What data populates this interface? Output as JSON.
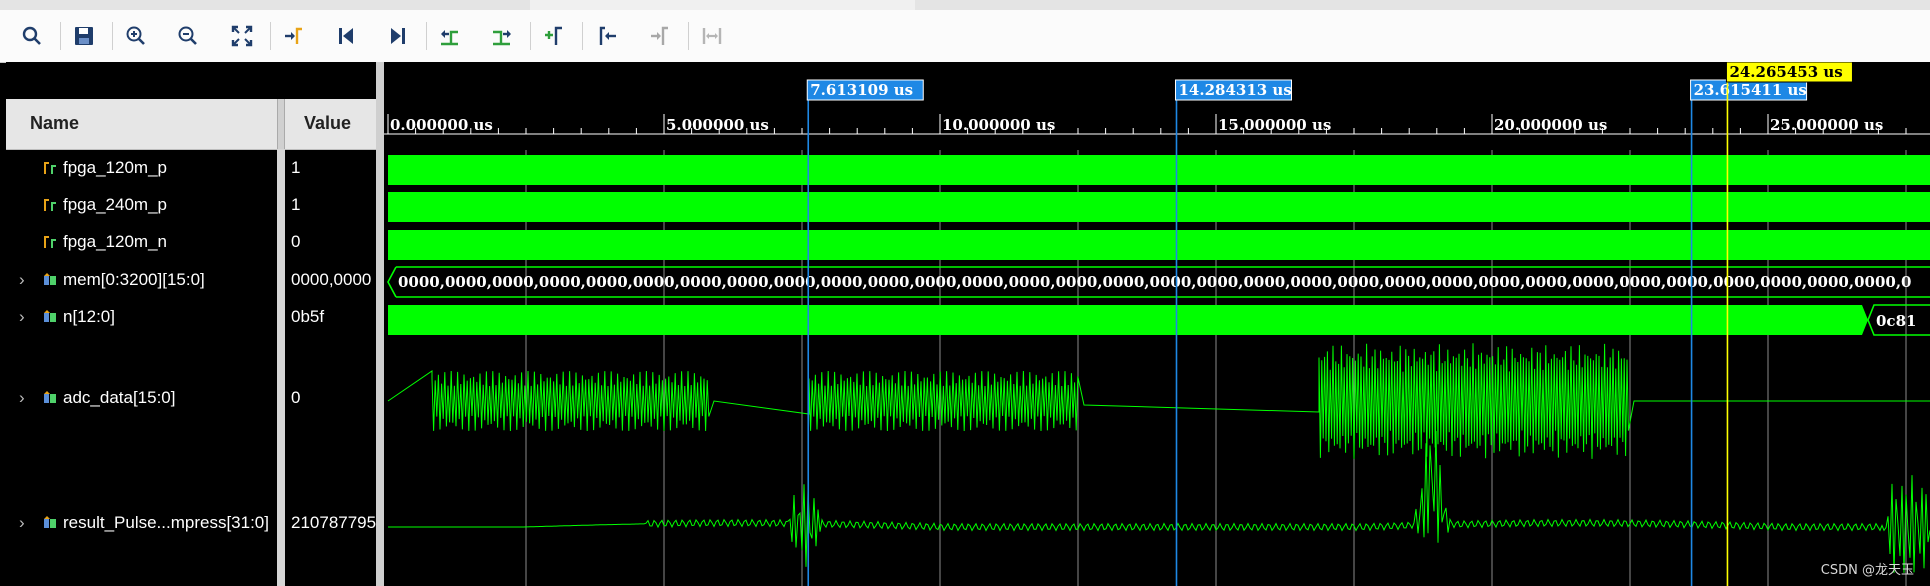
{
  "toolbar": {
    "buttons": [
      {
        "name": "search-button",
        "icon": "search-icon"
      },
      {
        "name": "save-button",
        "icon": "save-icon"
      },
      {
        "name": "zoom-in-button",
        "icon": "zoom-in-icon"
      },
      {
        "name": "zoom-out-button",
        "icon": "zoom-out-icon"
      },
      {
        "name": "zoom-fit-button",
        "icon": "zoom-fit-icon"
      },
      {
        "name": "goto-cursor-button",
        "icon": "goto-cursor-icon"
      },
      {
        "name": "goto-start-button",
        "icon": "goto-start-icon"
      },
      {
        "name": "goto-end-button",
        "icon": "goto-end-icon"
      },
      {
        "name": "previous-transition-button",
        "icon": "prev-transition-icon"
      },
      {
        "name": "next-transition-button",
        "icon": "next-transition-icon"
      },
      {
        "name": "add-marker-button",
        "icon": "add-marker-icon"
      },
      {
        "name": "previous-marker-button",
        "icon": "prev-marker-icon"
      },
      {
        "name": "next-marker-button",
        "icon": "next-marker-icon"
      },
      {
        "name": "swap-cursors-button",
        "icon": "swap-cursors-icon"
      }
    ]
  },
  "header": {
    "name_col": "Name",
    "value_col": "Value"
  },
  "signals": [
    {
      "name": "fpga_120m_p",
      "value": "1",
      "expandable": false,
      "icon": "bit-signal-icon"
    },
    {
      "name": "fpga_240m_p",
      "value": "1",
      "expandable": false,
      "icon": "bit-signal-icon"
    },
    {
      "name": "fpga_120m_n",
      "value": "0",
      "expandable": false,
      "icon": "bit-signal-icon"
    },
    {
      "name": "mem[0:3200][15:0]",
      "value": "0000,0000",
      "expandable": true,
      "icon": "bus-signal-icon"
    },
    {
      "name": "n[12:0]",
      "value": "0b5f",
      "expandable": true,
      "icon": "bus-signal-icon"
    },
    {
      "name": "adc_data[15:0]",
      "value": "0",
      "expandable": true,
      "icon": "bus-signal-icon"
    },
    {
      "name": "result_Pulse...mpress[31:0]",
      "value": "210787795",
      "expandable": true,
      "icon": "bus-signal-icon"
    }
  ],
  "timeline": {
    "ticks": [
      "0.000000 us",
      "5.000000 us",
      "10.000000 us",
      "15.000000 us",
      "20.000000 us",
      "25.000000 us"
    ],
    "tick_values_us": [
      0,
      5,
      10,
      15,
      20,
      25
    ],
    "us_per_major": 5
  },
  "markers": [
    {
      "label": "7.613109 us",
      "time_us": 7.613109,
      "kind": "marker",
      "color": "#1e88e5"
    },
    {
      "label": "14.284313 us",
      "time_us": 14.284313,
      "kind": "marker",
      "color": "#1e88e5"
    },
    {
      "label": "23.615411 us",
      "time_us": 23.615411,
      "kind": "marker",
      "color": "#1e88e5"
    },
    {
      "label": "24.265453 us",
      "time_us": 24.265453,
      "kind": "cursor",
      "color": "#ffff00"
    }
  ],
  "bus_text": {
    "mem_values": "0000,0000,0000,0000,0000,0000,0000,0000,0000,0000,0000,0000,0000,0000,0000,0000,0000,0000,0000,0000,0000,0000,0000,0000,0000,0000,0000,0000,0000,0000,0000,0000,0",
    "n_value": "0c81"
  },
  "watermark": "CSDN @龙天玉",
  "colors": {
    "wave": "#00ff00",
    "marker": "#1e88e5",
    "cursor": "#ffff00",
    "grid": "#8a8a8a",
    "background": "#000000"
  }
}
